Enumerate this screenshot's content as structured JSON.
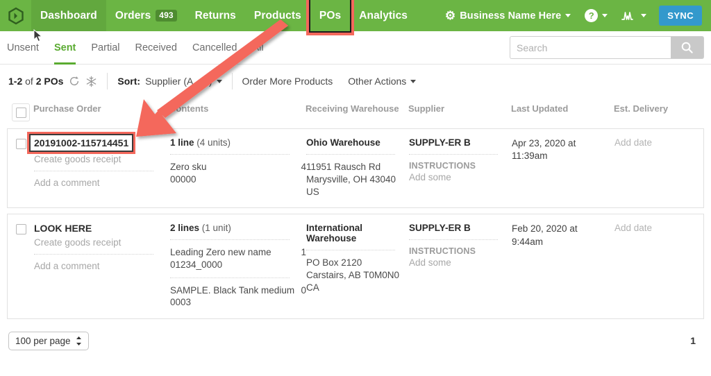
{
  "colors": {
    "brand_green": "#6bb544",
    "nav_active_green": "#62a83e",
    "badge_green": "#4e8c30",
    "tab_active_green": "#5aab31",
    "sync_blue": "#3399cc",
    "annotation_red": "#f4685c"
  },
  "navbar": {
    "logo_icon": "hexagon-chevron-logo",
    "items": [
      {
        "label": "Dashboard",
        "active": true
      },
      {
        "label": "Orders",
        "badge": "493",
        "active": false
      },
      {
        "label": "Returns",
        "active": false
      },
      {
        "label": "Products",
        "active": false
      },
      {
        "label": "POs",
        "active": false,
        "highlighted": true
      },
      {
        "label": "Analytics",
        "active": false
      }
    ],
    "account": {
      "gear_icon": "gear-icon",
      "label": "Business Name Here",
      "caret": "▾"
    },
    "help": {
      "icon": "question-mark-icon",
      "caret": "▾"
    },
    "activity": {
      "icon": "activity-chart-icon",
      "caret": "▾"
    },
    "sync_button": "SYNC"
  },
  "tabs": [
    {
      "label": "Unsent",
      "active": false
    },
    {
      "label": "Sent",
      "active": true
    },
    {
      "label": "Partial",
      "active": false
    },
    {
      "label": "Received",
      "active": false
    },
    {
      "label": "Cancelled",
      "active": false
    },
    {
      "label": "All",
      "active": false
    }
  ],
  "search": {
    "placeholder": "Search",
    "value": "",
    "button_icon": "search-icon"
  },
  "toolbar": {
    "count_prefix": "1-2",
    "count_middle": "of",
    "count_suffix": "2 POs",
    "refresh_icon": "refresh-icon",
    "freeze_icon": "snowflake-icon",
    "sort_label": "Sort:",
    "sort_value": "Supplier (A→Z)",
    "order_more_products": "Order More Products",
    "other_actions": "Other Actions",
    "other_actions_caret": "▾"
  },
  "table": {
    "headers": {
      "select_all": "",
      "purchase_order": "Purchase Order",
      "contents": "Contents",
      "receiving_warehouse": "Receiving Warehouse",
      "supplier": "Supplier",
      "last_updated": "Last Updated",
      "est_delivery": "Est. Delivery"
    },
    "rows": [
      {
        "po_number": "20191002-115714451",
        "po_highlighted": true,
        "create_goods_receipt": "Create goods receipt",
        "add_a_comment": "Add a comment",
        "contents_summary_bold": "1 line",
        "contents_summary_muted": "(4 units)",
        "line_items": [
          {
            "name": "Zero sku",
            "sku": "00000",
            "qty": "4"
          }
        ],
        "warehouse_name": "Ohio Warehouse",
        "warehouse_address": [
          "11951 Rausch Rd",
          "Marysville, OH 43040",
          "US"
        ],
        "supplier": "SUPPLY-ER B",
        "instructions_label": "INSTRUCTIONS",
        "instructions_action": "Add some",
        "last_updated": [
          "Apr 23, 2020 at",
          "11:39am"
        ],
        "est_delivery": "Add date"
      },
      {
        "po_number": "LOOK HERE",
        "po_highlighted": false,
        "create_goods_receipt": "Create goods receipt",
        "add_a_comment": "Add a comment",
        "contents_summary_bold": "2 lines",
        "contents_summary_muted": "(1 unit)",
        "line_items": [
          {
            "name": "Leading Zero new name",
            "sku": "01234_0000",
            "qty": "1"
          },
          {
            "name": "SAMPLE. Black Tank medium",
            "sku": "0003",
            "qty": "0"
          }
        ],
        "warehouse_name": "International Warehouse",
        "warehouse_address": [
          "PO Box 2120",
          "Carstairs, AB T0M0N0",
          "CA"
        ],
        "supplier": "SUPPLY-ER B",
        "instructions_label": "INSTRUCTIONS",
        "instructions_action": "Add some",
        "last_updated": [
          "Feb 20, 2020 at",
          "9:44am"
        ],
        "est_delivery": "Add date"
      }
    ]
  },
  "footer": {
    "per_page": "100 per page",
    "page_number": "1"
  },
  "annotation": {
    "arrow_color": "#f4685c",
    "description": "arrow-from-pos-tab-to-purchase-order-cell"
  }
}
